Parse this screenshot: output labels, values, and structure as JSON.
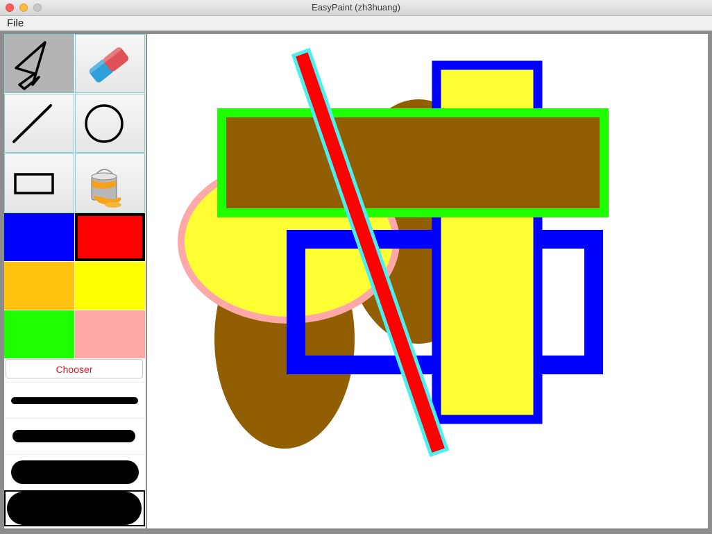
{
  "window": {
    "title": "EasyPaint (zh3huang)"
  },
  "menubar": {
    "items": [
      "File"
    ]
  },
  "tools": [
    {
      "name": "select",
      "icon": "cursor-arrow-icon",
      "selected": true
    },
    {
      "name": "eraser",
      "icon": "eraser-icon",
      "selected": false
    },
    {
      "name": "line",
      "icon": "line-icon",
      "selected": false
    },
    {
      "name": "circle",
      "icon": "circle-icon",
      "selected": false
    },
    {
      "name": "rectangle",
      "icon": "rectangle-icon",
      "selected": false
    },
    {
      "name": "fill",
      "icon": "paint-bucket-icon",
      "selected": false
    }
  ],
  "palette": [
    {
      "color": "#0000ff",
      "selected": false
    },
    {
      "color": "#ff0000",
      "selected": true
    },
    {
      "color": "#ffc20e",
      "selected": false
    },
    {
      "color": "#ffff00",
      "selected": false
    },
    {
      "color": "#1eff00",
      "selected": false
    },
    {
      "color": "#ffa8a8",
      "selected": false
    }
  ],
  "chooser": {
    "label": "Chooser",
    "color": "#e0141b"
  },
  "stroke_widths": [
    {
      "level": 1,
      "selected": false
    },
    {
      "level": 2,
      "selected": false
    },
    {
      "level": 3,
      "selected": false
    },
    {
      "level": 4,
      "selected": true
    }
  ],
  "canvas": {
    "shapes": [
      {
        "type": "ellipse",
        "fill": "#925e02"
      },
      {
        "type": "ellipse",
        "fill": "#925e02"
      },
      {
        "type": "ellipse",
        "fill": "#ffff33",
        "stroke": "#ffa8a8"
      },
      {
        "type": "rectangle-outline",
        "stroke": "#0000ff"
      },
      {
        "type": "rectangle",
        "fill": "#ffff33",
        "stroke": "#0000ff"
      },
      {
        "type": "rectangle",
        "fill": "#925e02",
        "stroke": "#1eff00"
      },
      {
        "type": "line",
        "fill": "#ff0000",
        "stroke": "#4af0f0"
      }
    ]
  }
}
